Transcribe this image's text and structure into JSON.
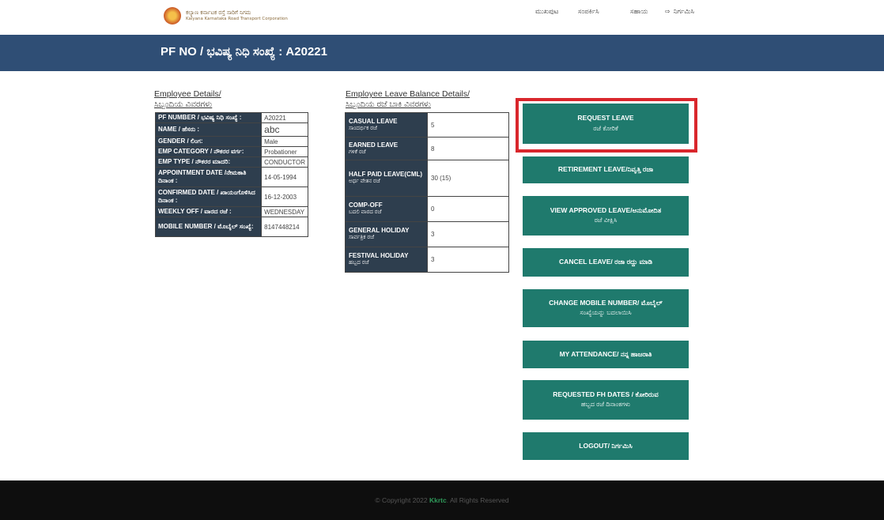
{
  "header": {
    "logo_kn": "ಕಲ್ಯಾಣ ಕರ್ನಾಟಕ ರಸ್ತೆ ಸಾರಿಗೆ ನಿಗಮ",
    "logo_en": "Kalyana Karnataka Road Transport Corporation",
    "nav": [
      {
        "label": "ಮುಖಪುಟ"
      },
      {
        "label": "ಸಂಪರ್ಕಿಸಿ"
      },
      {
        "label": "ಸಹಾಯ"
      },
      {
        "label": "ನಿರ್ಗಮಿಸಿ",
        "icon": "logout-icon"
      }
    ]
  },
  "banner": {
    "title": "PF NO / ಭವಿಷ್ಯ ನಿಧಿ ಸಂಖ್ಯೆ : A20221"
  },
  "employee_details": {
    "title_en": "Employee Details/",
    "title_kn": "ಸಿಬ್ಬಂದಿಯ ವಿವರಗಳು",
    "rows": [
      {
        "label": "PF NUMBER / ಭವಿಷ್ಯ ನಿಧಿ ಸಂಖ್ಯೆ :",
        "value": "A20221"
      },
      {
        "label": "NAME / ಹೆಸರು :",
        "value": "abc"
      },
      {
        "label": "GENDER / ಲಿಂಗ:",
        "value": "Male"
      },
      {
        "label": "EMP CATEGORY / ನೌಕರರ ವರ್ಗ:",
        "value": "Probationer"
      },
      {
        "label": "EMP TYPE / ನೌಕರರ ಮಾದರಿ:",
        "value": "CONDUCTOR"
      },
      {
        "label": "APPOINTMENT DATE /ನೇಮಕಾತಿ ದಿನಾಂಕ :",
        "value": "14-05-1994"
      },
      {
        "label": "CONFIRMED DATE / ಖಾಯಂಗೊಳಿಸಿದ ದಿನಾಂಕ :",
        "value": "16-12-2003"
      },
      {
        "label": "WEEKLY OFF / ವಾರದ ರಜೆ :",
        "value": "WEDNESDAY"
      },
      {
        "label": "MOBILE NUMBER / ಮೊಬೈಲ್ ಸಂಖ್ಯೆ:",
        "value": "8147448214"
      }
    ]
  },
  "leave_balance": {
    "title_en": "Employee Leave Balance Details/",
    "title_kn": "ಸಿಬ್ಬಂದಿಯ ರಜೆ ಬಾಕಿ ವಿವರಗಳು",
    "rows": [
      {
        "label": "CASUAL LEAVE",
        "label_kn": "ಸಾಂದರ್ಭಿಕ ರಜೆ",
        "value": "5"
      },
      {
        "label": "EARNED LEAVE",
        "label_kn": "ಗಳಿಕೆ ರಜೆ",
        "value": "8"
      },
      {
        "label": "HALF PAID LEAVE(CML)",
        "label_kn": "ಅರ್ಧ ವೇತನ ರಜೆ",
        "value": "30 (15)"
      },
      {
        "label": "COMP-OFF",
        "label_kn": "ಬದಲಿ ವಾರದ ರಜೆ",
        "value": "0"
      },
      {
        "label": "GENERAL HOLIDAY",
        "label_kn": "ಸಾರ್ವತ್ರಿಕ ರಜೆ",
        "value": "3"
      },
      {
        "label": "FESTIVAL HOLIDAY",
        "label_kn": "ಹಬ್ಬದ ರಜೆ",
        "value": "3"
      }
    ]
  },
  "actions": {
    "request_leave": {
      "line1": "REQUEST LEAVE",
      "line2": "ರಜೆ ಕೋರಿಕೆ"
    },
    "retirement_leave": {
      "line1": "RETIREMENT LEAVE/ನಿವೃತ್ತಿ ರಜಾ"
    },
    "view_approved": {
      "line1": "VIEW APPROVED LEAVE/ಅನುಮೋದಿತ",
      "line2": "ರಜೆ ವೀಕ್ಷಿಸಿ"
    },
    "cancel_leave": {
      "line1": "CANCEL LEAVE/ ರಜಾ ರದ್ದು ಮಾಡಿ"
    },
    "change_mobile": {
      "line1": "CHANGE MOBILE NUMBER/ ಮೊಬೈಲ್",
      "line2": "ಸಂಖ್ಯೆಯನ್ನು ಬದಲಾಯಿಸಿ"
    },
    "attendance": {
      "line1": "MY ATTENDANCE/ ನನ್ನ ಹಾಜರಾತಿ"
    },
    "requested_fh": {
      "line1": "REQUESTED FH DATES / ಕೋರಿರುವ",
      "line2": "ಹಬ್ಬದ ರಜೆ ದಿನಾಂಕಗಳು"
    },
    "logout": {
      "line1": "LOGOUT/ ನಿರ್ಗಮಿಸಿ"
    }
  },
  "footer": {
    "prefix": "© Copyright 2022",
    "brand": "Kkrtc",
    "suffix": ". All Rights Reserved"
  },
  "colors": {
    "banner": "#2f4e75",
    "button": "#1f7a6d",
    "table_header": "#2e3e4e",
    "highlight": "#d9262c",
    "footer": "#0e0e0e"
  }
}
